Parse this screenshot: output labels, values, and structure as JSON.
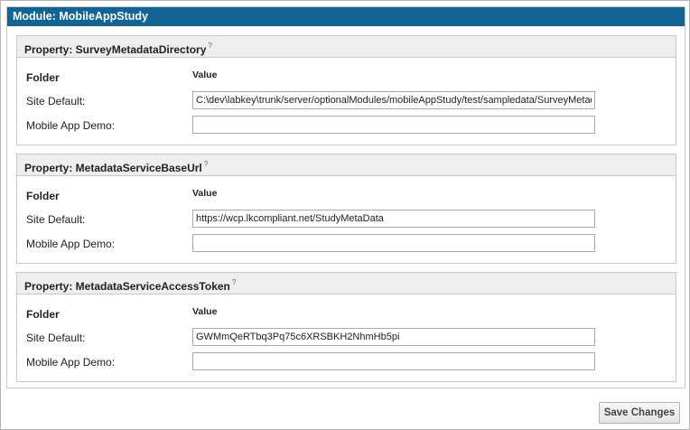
{
  "module": {
    "title": "Module: MobileAppStudy"
  },
  "properties": [
    {
      "header": "Property: SurveyMetadataDirectory",
      "help": "?",
      "folder_heading": "Folder",
      "value_heading": "Value",
      "rows": [
        {
          "label": "Site Default:",
          "value": "C:\\dev\\labkey\\trunk/server/optionalModules/mobileAppStudy/test/sampledata/SurveyMetadata"
        },
        {
          "label": "Mobile App Demo:",
          "value": ""
        }
      ]
    },
    {
      "header": "Property: MetadataServiceBaseUrl",
      "help": "?",
      "folder_heading": "Folder",
      "value_heading": "Value",
      "rows": [
        {
          "label": "Site Default:",
          "value": "https://wcp.lkcompliant.net/StudyMetaData"
        },
        {
          "label": "Mobile App Demo:",
          "value": ""
        }
      ]
    },
    {
      "header": "Property: MetadataServiceAccessToken",
      "help": "?",
      "folder_heading": "Folder",
      "value_heading": "Value",
      "rows": [
        {
          "label": "Site Default:",
          "value": "GWMmQeRTbq3Pq75c6XRSBKH2NhmHb5pi"
        },
        {
          "label": "Mobile App Demo:",
          "value": ""
        }
      ]
    }
  ],
  "actions": {
    "save_label": "Save Changes"
  },
  "colors": {
    "header_bg": "#126495",
    "section_header_bg": "#eeeeee"
  }
}
